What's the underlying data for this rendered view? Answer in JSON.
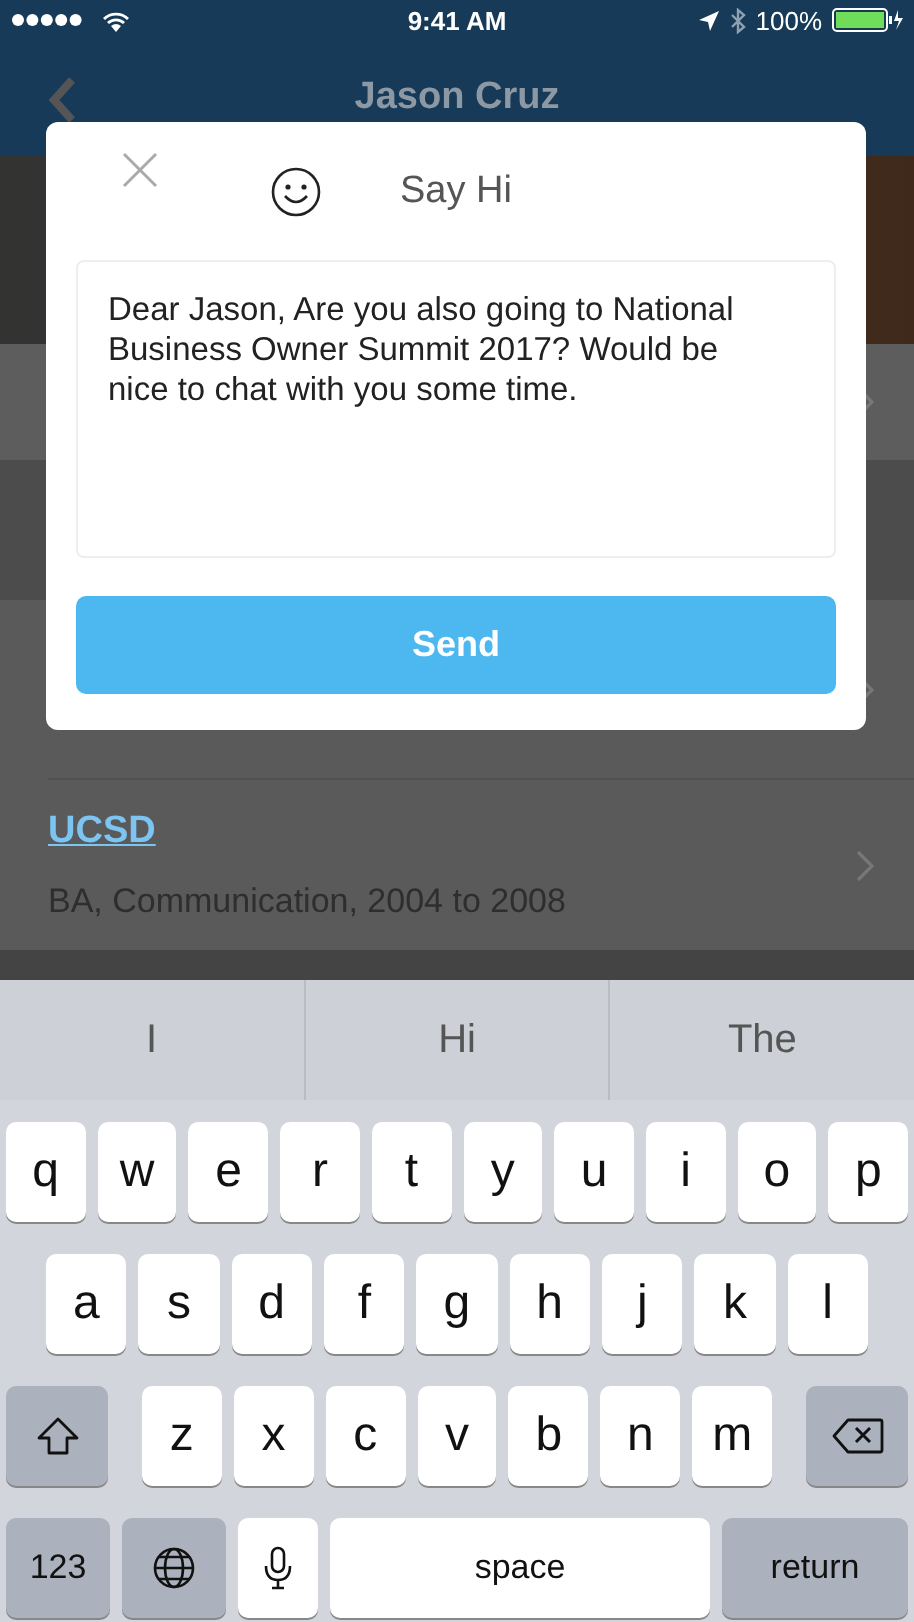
{
  "status_bar": {
    "time": "9:41 AM",
    "battery": "100%"
  },
  "nav": {
    "title": "Jason Cruz"
  },
  "education": [
    {
      "school": "UCSD",
      "degree": "BA, Communication, 2004 to 2008"
    }
  ],
  "dialog": {
    "title": "Say Hi",
    "message": "Dear Jason, Are you also going to National Business Owner Summit 2017? Would be nice to chat with you some time.",
    "button": "Send"
  },
  "keyboard": {
    "suggestions": [
      "I",
      "Hi",
      "The"
    ],
    "rows": [
      [
        "q",
        "w",
        "e",
        "r",
        "t",
        "y",
        "u",
        "i",
        "o",
        "p"
      ],
      [
        "a",
        "s",
        "d",
        "f",
        "g",
        "h",
        "j",
        "k",
        "l"
      ],
      [
        "z",
        "x",
        "c",
        "v",
        "b",
        "n",
        "m"
      ]
    ],
    "number_key": "123",
    "space_key": "space",
    "return_key": "return"
  }
}
